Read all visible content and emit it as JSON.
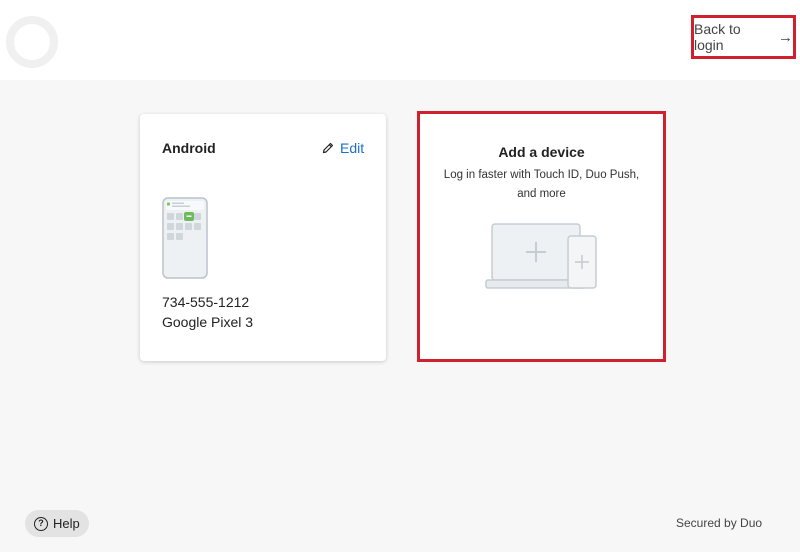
{
  "header": {
    "back_link_label": "Back to login",
    "back_arrow": "→"
  },
  "devices": [
    {
      "name": "Android",
      "edit_label": "Edit",
      "phone_number": "734-555-1212",
      "model": "Google Pixel 3"
    }
  ],
  "add_device": {
    "title": "Add a device",
    "subtitle": "Log in faster with Touch ID, Duo Push, and more"
  },
  "footer": {
    "help_label": "Help",
    "help_icon_glyph": "?",
    "secured_text": "Secured by Duo"
  },
  "icons": {
    "logo": "duo-logo-icon",
    "back": "arrow-right-icon",
    "edit": "pencil-icon",
    "help": "question-circle-icon",
    "phone": "phone-illustration-icon",
    "add_devices": "laptop-phone-plus-icon"
  },
  "colors": {
    "highlight": "#d0202e",
    "link": "#1a6fc9",
    "background": "#f7f7f7"
  }
}
